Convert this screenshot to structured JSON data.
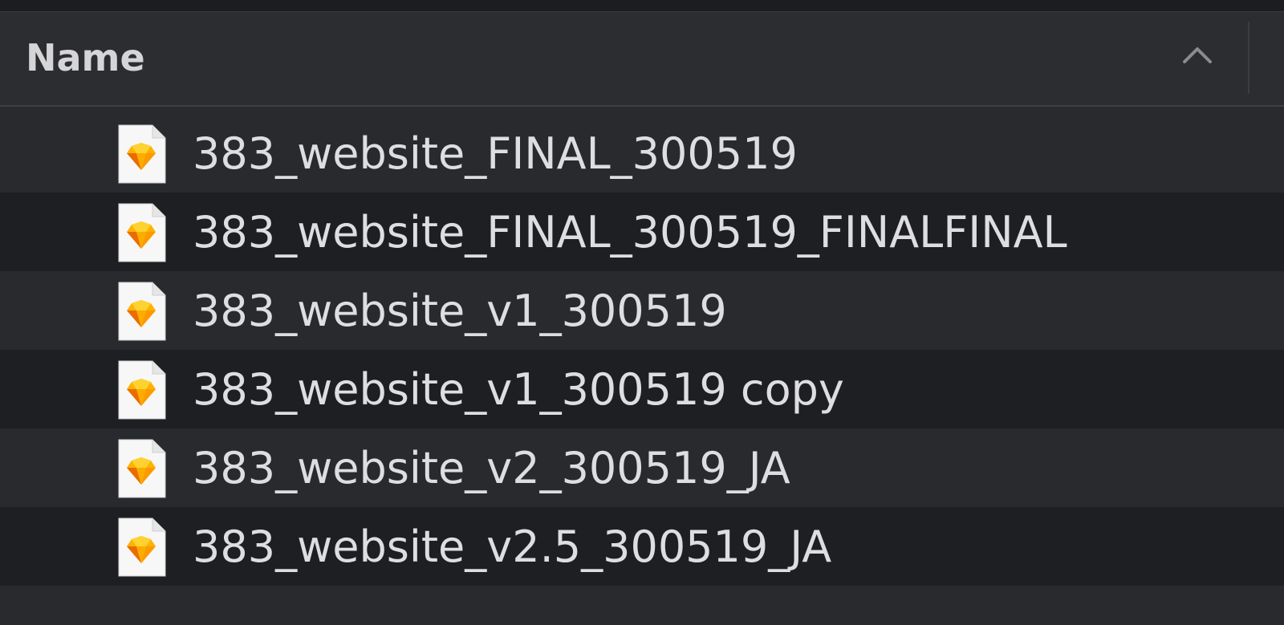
{
  "header": {
    "column_label": "Name",
    "sort_icon": "chevron-up-icon"
  },
  "files": [
    {
      "name": "383_website_FINAL_300519",
      "icon": "sketch-file-icon"
    },
    {
      "name": "383_website_FINAL_300519_FINALFINAL",
      "icon": "sketch-file-icon"
    },
    {
      "name": "383_website_v1_300519",
      "icon": "sketch-file-icon"
    },
    {
      "name": "383_website_v1_300519 copy",
      "icon": "sketch-file-icon"
    },
    {
      "name": "383_website_v2_300519_JA",
      "icon": "sketch-file-icon"
    },
    {
      "name": "383_website_v2.5_300519_JA",
      "icon": "sketch-file-icon"
    }
  ],
  "colors": {
    "background": "#292a2e",
    "alt_row": "#1e1f22",
    "text": "#dedee0",
    "icon_orange": "#fdad00",
    "icon_yellow": "#fdd231"
  }
}
